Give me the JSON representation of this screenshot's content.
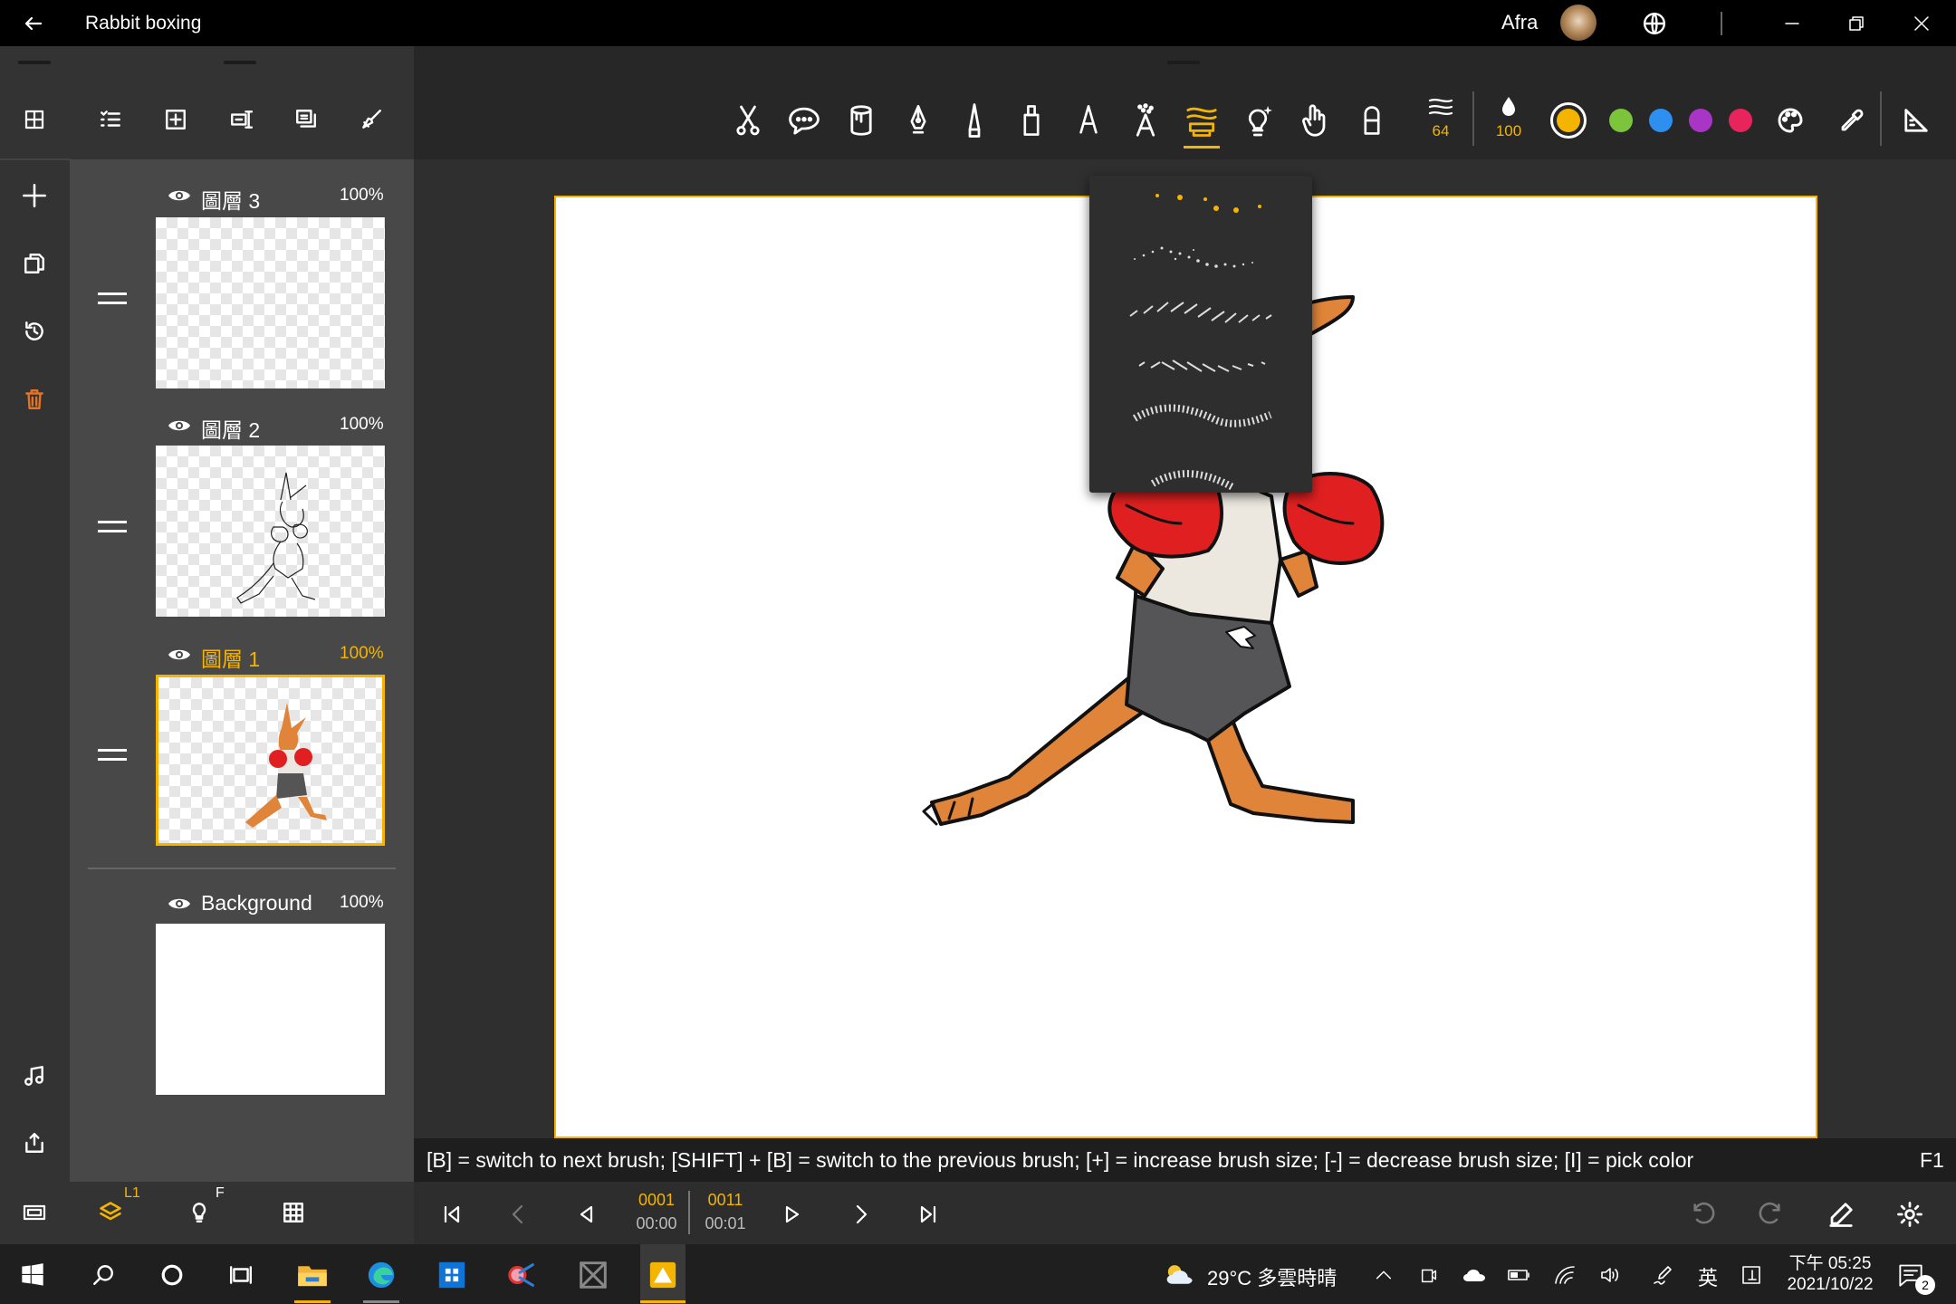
{
  "app": {
    "title": "Rabbit boxing",
    "user": "Afra"
  },
  "layers": [
    {
      "name": "圖層 3",
      "opacity": "100%",
      "active": false
    },
    {
      "name": "圖層 2",
      "opacity": "100%",
      "active": false
    },
    {
      "name": "圖層 1",
      "opacity": "100%",
      "active": true
    },
    {
      "name": "Background",
      "opacity": "100%",
      "active": false
    }
  ],
  "toolbar": {
    "brush_size": "64",
    "opacity": "100",
    "colors": [
      "#f4b400",
      "#7cc43c",
      "#2d8ff0",
      "#a935c7",
      "#e8245c"
    ],
    "accent": "#f4b400"
  },
  "hint": {
    "text": "[B] = switch to next brush; [SHIFT] + [B] = switch to the previous brush; [+] = increase brush size; [-] = decrease brush size; [I] = pick color",
    "key": "F1"
  },
  "bottom_left": {
    "layer_badge": "L1",
    "onion_badge": "F"
  },
  "timeline": {
    "current_frame": "0001",
    "current_time": "00:00",
    "total_frames": "0011",
    "total_time": "00:01"
  },
  "taskbar": {
    "weather": "29°C  多雲時晴",
    "ime": "英",
    "time": "下午 05:25",
    "date": "2021/10/22",
    "notifications": "2"
  }
}
